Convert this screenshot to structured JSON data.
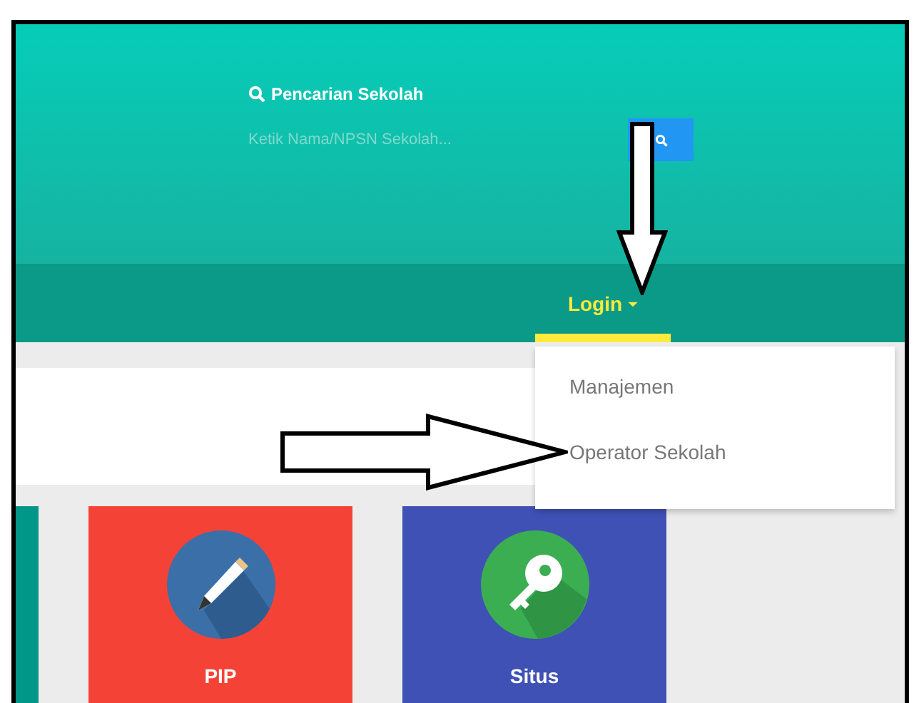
{
  "header": {
    "search_label": "Pencarian Sekolah",
    "search_placeholder": "Ketik Nama/NPSN Sekolah..."
  },
  "nav": {
    "login": "Login",
    "expanded": true
  },
  "dropdown": [
    {
      "label": "Manajemen"
    },
    {
      "label": "Operator Sekolah"
    }
  ],
  "tiles": [
    {
      "kind": "partial",
      "color": "#009688"
    },
    {
      "kind": "pencil",
      "title": "PIP",
      "color": "#f44336"
    },
    {
      "kind": "key",
      "title": "Situs",
      "color": "#3f51b5"
    }
  ]
}
